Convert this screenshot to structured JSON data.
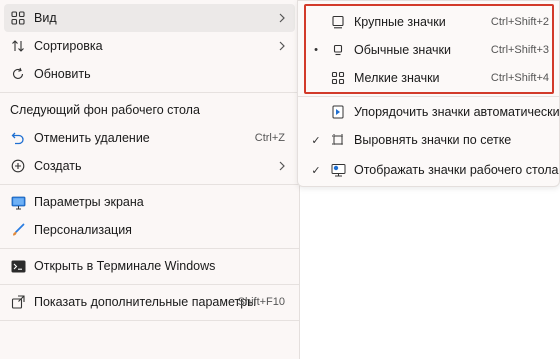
{
  "main_menu": {
    "view": {
      "label": "Вид",
      "icon": "grid-icon"
    },
    "sort": {
      "label": "Сортировка",
      "icon": "sort-arrows-icon"
    },
    "refresh": {
      "label": "Обновить",
      "icon": "refresh-icon"
    },
    "next_background": {
      "label": "Следующий фон рабочего стола"
    },
    "undo_delete": {
      "label": "Отменить удаление",
      "shortcut": "Ctrl+Z",
      "icon": "undo-icon"
    },
    "create": {
      "label": "Создать",
      "icon": "plus-circle-icon"
    },
    "display_settings": {
      "label": "Параметры экрана",
      "icon": "monitor-icon"
    },
    "personalize": {
      "label": "Персонализация",
      "icon": "brush-icon"
    },
    "open_terminal": {
      "label": "Открыть в Терминале Windows",
      "icon": "terminal-icon"
    },
    "more_options": {
      "label": "Показать дополнительные параметры",
      "shortcut": "Shift+F10",
      "icon": "share-icon"
    }
  },
  "view_submenu": {
    "large_icons": {
      "label": "Крупные значки",
      "shortcut": "Ctrl+Shift+2",
      "selected": false
    },
    "medium_icons": {
      "label": "Обычные значки",
      "shortcut": "Ctrl+Shift+3",
      "selected": true,
      "mark": "•"
    },
    "small_icons": {
      "label": "Мелкие значки",
      "shortcut": "Ctrl+Shift+4",
      "selected": false
    },
    "auto_arrange": {
      "label": "Упорядочить значки автоматически",
      "checked": false
    },
    "align_to_grid": {
      "label": "Выровнять значки по сетке",
      "checked": true,
      "mark": "✓"
    },
    "show_icons": {
      "label": "Отображать значки рабочего стола",
      "checked": true,
      "mark": "✓"
    }
  },
  "colors": {
    "highlight_border": "#d23a2a",
    "accent_blue": "#1f6fd1"
  }
}
